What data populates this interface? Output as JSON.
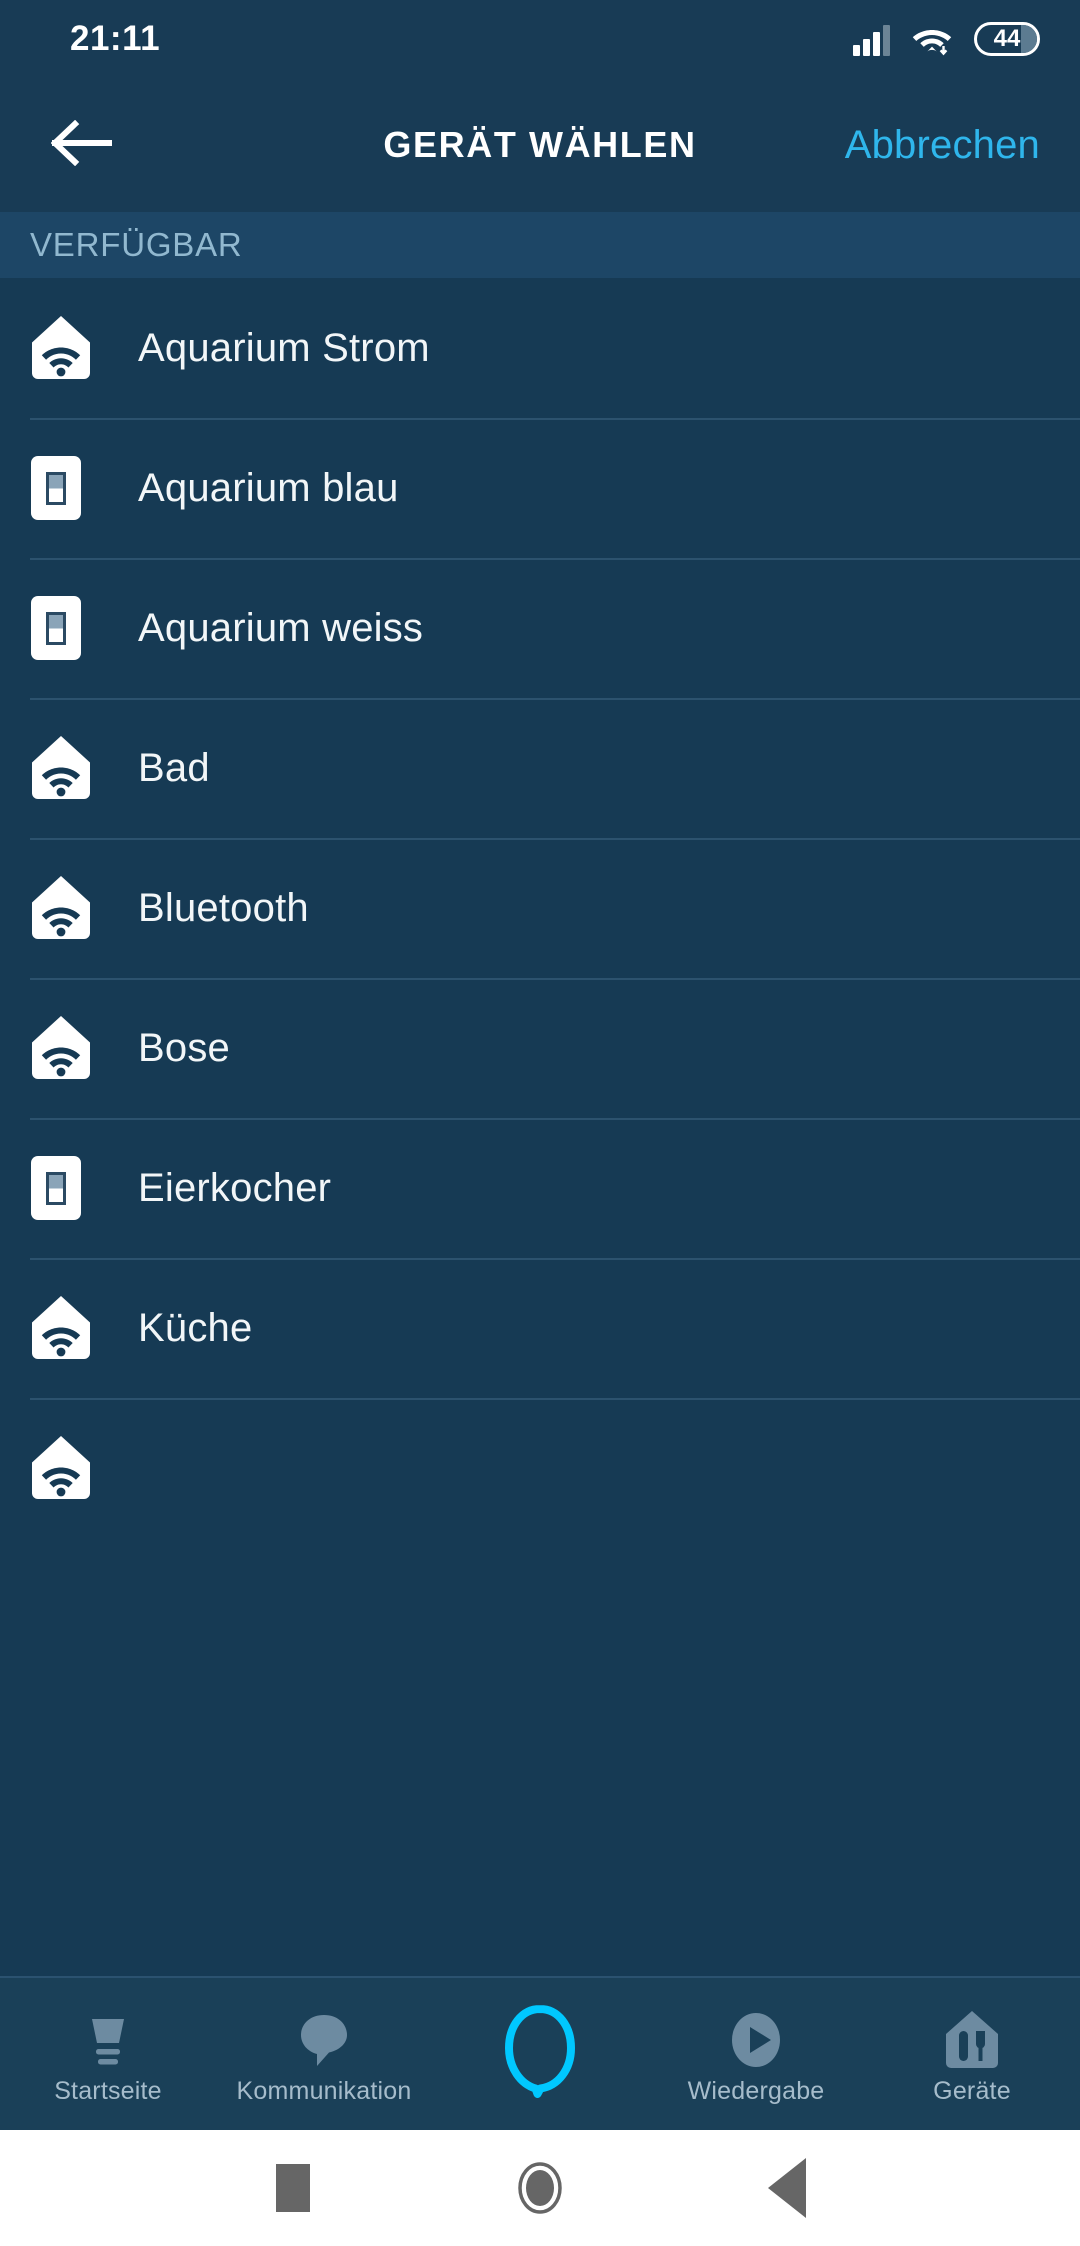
{
  "status_bar": {
    "time": "21:11",
    "battery_level": "44",
    "signal_icon": "signal-bars-icon",
    "wifi_icon": "wifi-icon",
    "battery_icon": "battery-icon"
  },
  "header": {
    "title": "GERÄT WÄHLEN",
    "back_icon": "back-arrow-icon",
    "cancel_label": "Abbrechen",
    "accent_color": "#2fb6ec"
  },
  "section": {
    "label": "VERFÜGBAR"
  },
  "devices": [
    {
      "label": "Aquarium Strom",
      "icon": "echo-home-wifi-icon"
    },
    {
      "label": "Aquarium blau",
      "icon": "light-switch-icon"
    },
    {
      "label": "Aquarium weiss",
      "icon": "light-switch-icon"
    },
    {
      "label": "Bad",
      "icon": "echo-home-wifi-icon"
    },
    {
      "label": "Bluetooth",
      "icon": "echo-home-wifi-icon"
    },
    {
      "label": "Bose",
      "icon": "echo-home-wifi-icon"
    },
    {
      "label": "Eierkocher",
      "icon": "light-switch-icon"
    },
    {
      "label": "Küche",
      "icon": "echo-home-wifi-icon"
    },
    {
      "label": "",
      "icon": "echo-home-wifi-icon"
    }
  ],
  "bottom_nav": [
    {
      "label": "Startseite",
      "icon": "home-icon",
      "active": false
    },
    {
      "label": "Kommunikation",
      "icon": "speech-bubble-icon",
      "active": false
    },
    {
      "label": "",
      "icon": "alexa-ring-icon",
      "active": true
    },
    {
      "label": "Wiedergabe",
      "icon": "play-circle-icon",
      "active": false
    },
    {
      "label": "Geräte",
      "icon": "devices-icon",
      "active": false
    }
  ],
  "android_nav": {
    "recents_icon": "square-recents-icon",
    "home_icon": "circle-home-icon",
    "back_icon": "triangle-back-icon"
  },
  "colors": {
    "background": "#163a54",
    "header_bg": "#183b55",
    "section_bg": "#1d4666",
    "accent_cyan": "#00c8ff",
    "divider": "#2c526e"
  }
}
